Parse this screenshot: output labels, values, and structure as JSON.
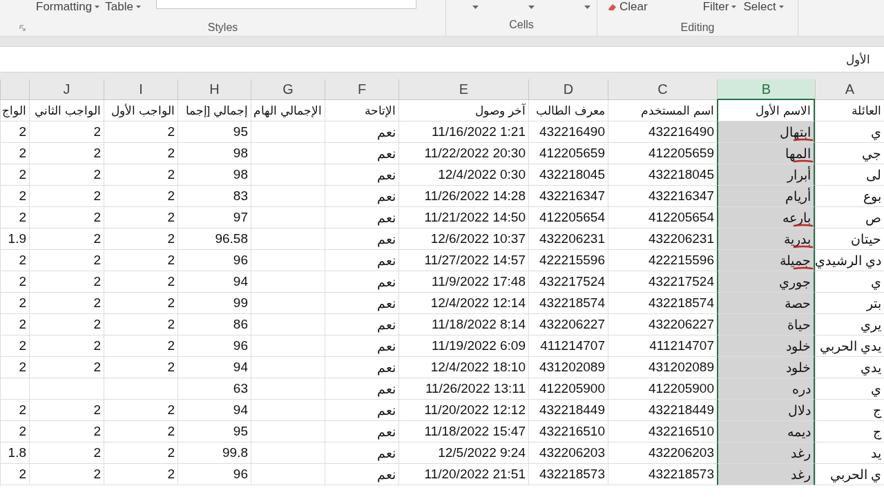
{
  "ribbon": {
    "groups": [
      {
        "kind": "editing",
        "label": "Editing",
        "buttons": [
          "Select",
          "Filter",
          "Clear"
        ]
      },
      {
        "kind": "cells",
        "label": "Cells"
      },
      {
        "kind": "styles",
        "label": "Styles",
        "buttons": [
          "Table",
          "Formatting"
        ]
      }
    ]
  },
  "formula_bar": {
    "value": "الأول"
  },
  "columns": [
    {
      "letter": "A",
      "selected": false
    },
    {
      "letter": "B",
      "selected": true
    },
    {
      "letter": "C",
      "selected": false
    },
    {
      "letter": "D",
      "selected": false
    },
    {
      "letter": "E",
      "selected": false
    },
    {
      "letter": "F",
      "selected": false
    },
    {
      "letter": "G",
      "selected": false
    },
    {
      "letter": "H",
      "selected": false
    },
    {
      "letter": "I",
      "selected": false
    },
    {
      "letter": "J",
      "selected": false
    },
    {
      "selected": false
    }
  ],
  "header_row": [
    "العائلة",
    "الاسم الأول",
    "اسم المستخدم",
    "معرف الطالب",
    "آخر وصول",
    "الإتاحة",
    "الإجمالي الهام",
    "إجمالي [إجما",
    "الواجب الأول",
    "الواجب الثاني",
    "الواج"
  ],
  "rows": [
    {
      "annotated": true,
      "cells": [
        "ي",
        "ابتهال",
        "432216490",
        "432216490",
        "11/16/2022 1:21",
        "نعم",
        null,
        "95",
        "2",
        "2",
        "2"
      ]
    },
    {
      "annotated": true,
      "cells": [
        "جي",
        "المها",
        "412205659",
        "412205659",
        "11/22/2022 20:30",
        "نعم",
        null,
        "98",
        "2",
        "2",
        "2"
      ]
    },
    {
      "annotated": false,
      "cells": [
        "لى",
        "أبرار",
        "432218045",
        "432218045",
        "12/4/2022 0:30",
        "نعم",
        null,
        "98",
        "2",
        "2",
        "2"
      ]
    },
    {
      "annotated": false,
      "cells": [
        "بوع",
        "أريام",
        "432216347",
        "432216347",
        "11/26/2022 14:28",
        "نعم",
        null,
        "83",
        "2",
        "2",
        "2"
      ]
    },
    {
      "annotated": true,
      "cells": [
        "ص",
        "بارعه",
        "412205654",
        "412205654",
        "11/21/2022 14:50",
        "نعم",
        null,
        "97",
        "2",
        "2",
        "2"
      ]
    },
    {
      "annotated": true,
      "cells": [
        "حيتان",
        "بدرية",
        "432206231",
        "432206231",
        "12/6/2022 10:37",
        "نعم",
        null,
        "96.58",
        "2",
        "2",
        "1.9"
      ]
    },
    {
      "annotated": true,
      "cells": [
        "دي الرشيدي",
        "جميلة",
        "422215596",
        "422215596",
        "11/27/2022 14:57",
        "نعم",
        null,
        "96",
        "2",
        "2",
        "2"
      ]
    },
    {
      "annotated": false,
      "cells": [
        "ي",
        "جوري",
        "432217524",
        "432217524",
        "11/9/2022 17:48",
        "نعم",
        null,
        "94",
        "2",
        "2",
        "2"
      ]
    },
    {
      "annotated": false,
      "cells": [
        "بتر",
        "حصة",
        "432218574",
        "432218574",
        "12/4/2022 12:14",
        "نعم",
        null,
        "99",
        "2",
        "2",
        "2"
      ]
    },
    {
      "annotated": false,
      "cells": [
        "يري",
        "حياة",
        "432206227",
        "432206227",
        "11/18/2022 8:14",
        "نعم",
        null,
        "86",
        "2",
        "2",
        "2"
      ]
    },
    {
      "annotated": false,
      "cells": [
        "يدي الحربي",
        "خلود",
        "411214707",
        "411214707",
        "11/19/2022 6:09",
        "نعم",
        null,
        "96",
        "2",
        "2",
        "2"
      ]
    },
    {
      "annotated": false,
      "cells": [
        "يدي",
        "خلود",
        "431202089",
        "431202089",
        "12/4/2022 18:10",
        "نعم",
        null,
        "94",
        "2",
        "2",
        "2"
      ]
    },
    {
      "annotated": false,
      "cells": [
        "ي",
        "دره",
        "412205900",
        "412205900",
        "11/26/2022 13:11",
        "نعم",
        null,
        "63",
        null,
        null,
        null
      ]
    },
    {
      "annotated": false,
      "cells": [
        "ج",
        "دلال",
        "432218449",
        "432218449",
        "11/20/2022 12:12",
        "نعم",
        null,
        "94",
        "2",
        "2",
        "2"
      ]
    },
    {
      "annotated": false,
      "cells": [
        "ج",
        "ديمه",
        "432216510",
        "432216510",
        "11/18/2022 15:47",
        "نعم",
        null,
        "95",
        "2",
        "2",
        "2"
      ]
    },
    {
      "annotated": false,
      "cells": [
        "يد",
        "رغد",
        "432206203",
        "432206203",
        "12/5/2022 9:24",
        "نعم",
        null,
        "99.8",
        "2",
        "2",
        "1.8"
      ]
    },
    {
      "annotated": false,
      "cells": [
        "ي الحربي",
        "رغد",
        "432218573",
        "432218573",
        "11/20/2022 21:51",
        "نعم",
        null,
        "96",
        "2",
        "2",
        "2"
      ]
    }
  ]
}
